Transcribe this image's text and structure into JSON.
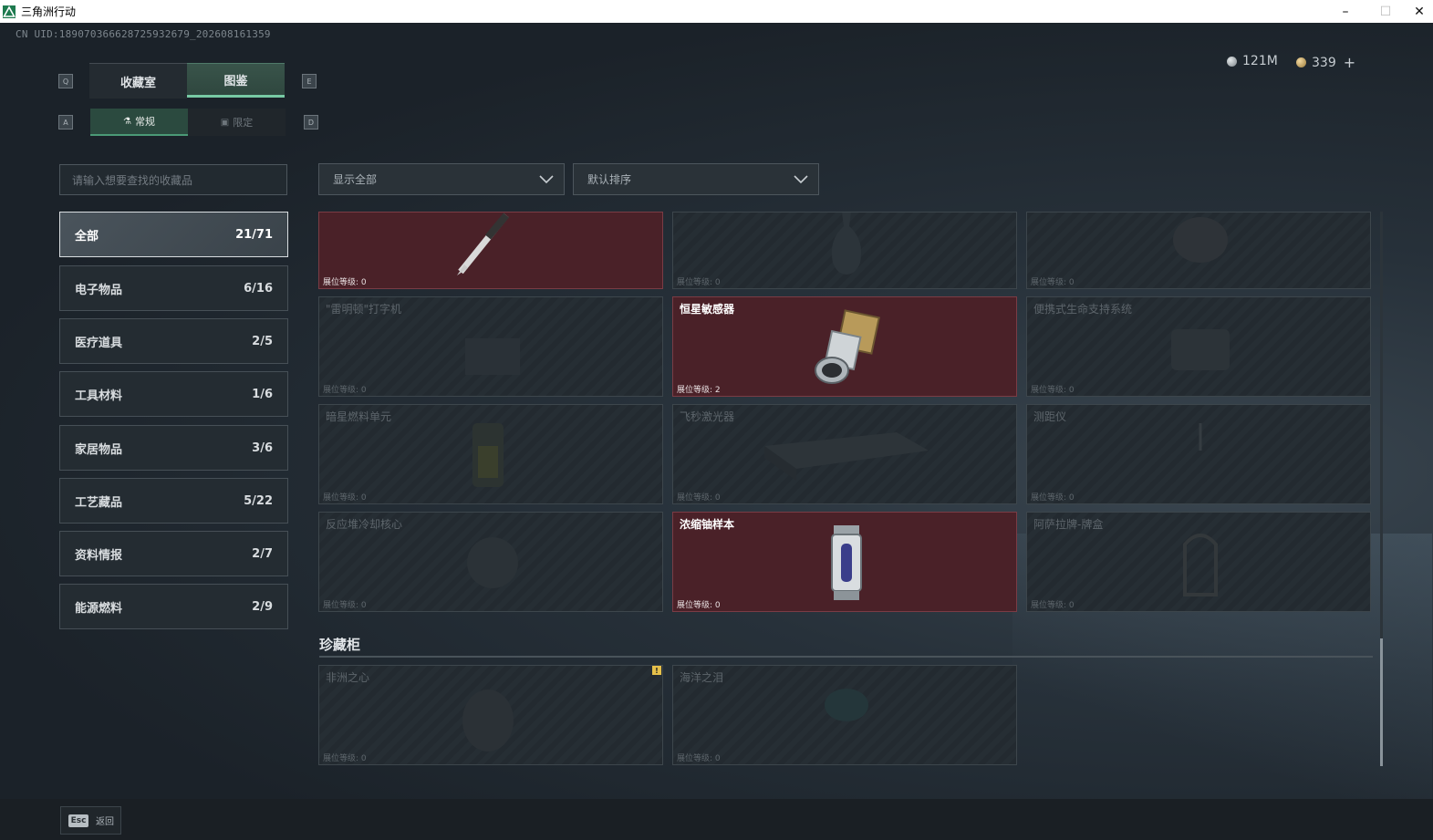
{
  "window": {
    "title": "三角洲行动",
    "minimize": "–",
    "maximize": "☐",
    "close": "✕"
  },
  "uid": "CN UID:18907036662872593267​9_202608161359",
  "currency": {
    "silver": "121M",
    "gold": "339",
    "add": "+"
  },
  "keys": {
    "q": "Q",
    "e": "E",
    "a": "A",
    "d": "D"
  },
  "tabs": [
    {
      "label": "收藏室"
    },
    {
      "label": "图鉴"
    }
  ],
  "subtabs": [
    {
      "label": "常规"
    },
    {
      "label": "限定"
    }
  ],
  "search": {
    "placeholder": "请输入想要查找的收藏品"
  },
  "filters": {
    "show": "显示全部",
    "sort": "默认排序"
  },
  "categories": [
    {
      "label": "全部",
      "count": "21/71"
    },
    {
      "label": "电子物品",
      "count": "6/16"
    },
    {
      "label": "医疗道具",
      "count": "2/5"
    },
    {
      "label": "工具材料",
      "count": "1/6"
    },
    {
      "label": "家居物品",
      "count": "3/6"
    },
    {
      "label": "工艺藏品",
      "count": "5/22"
    },
    {
      "label": "资料情报",
      "count": "2/7"
    },
    {
      "label": "能源燃料",
      "count": "2/9"
    }
  ],
  "items": [
    {
      "name": "",
      "level": "展位等级: 0",
      "owned": true
    },
    {
      "name": "",
      "level": "展位等级: 0",
      "owned": false
    },
    {
      "name": "",
      "level": "展位等级: 0",
      "owned": false
    },
    {
      "name": "\"雷明顿\"打字机",
      "level": "展位等级: 0",
      "owned": false
    },
    {
      "name": "恒星敏感器",
      "level": "展位等级: 2",
      "owned": true
    },
    {
      "name": "便携式生命支持系统",
      "level": "展位等级: 0",
      "owned": false
    },
    {
      "name": "暗星燃料单元",
      "level": "展位等级: 0",
      "owned": false
    },
    {
      "name": "飞秒激光器",
      "level": "展位等级: 0",
      "owned": false
    },
    {
      "name": "测距仪",
      "level": "展位等级: 0",
      "owned": false
    },
    {
      "name": "反应堆冷却核心",
      "level": "展位等级: 0",
      "owned": false
    },
    {
      "name": "浓缩铀样本",
      "level": "展位等级: 0",
      "owned": true
    },
    {
      "name": "阿萨拉牌-牌盒",
      "level": "展位等级: 0",
      "owned": false
    }
  ],
  "treasure": {
    "title": "珍藏柜",
    "items": [
      {
        "name": "非洲之心",
        "level": "展位等级: 0",
        "warn": "!"
      },
      {
        "name": "海洋之泪",
        "level": "展位等级: 0"
      }
    ]
  },
  "footer": {
    "esc": "Esc",
    "back": "返回"
  },
  "colors": {
    "accent": "#77c9a4",
    "owned_card": "#4a2128",
    "warning": "#e6c04a"
  }
}
